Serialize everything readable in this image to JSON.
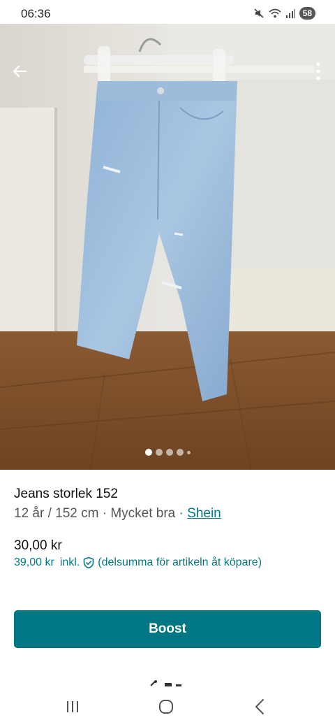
{
  "status_bar": {
    "time": "06:36",
    "battery": "58"
  },
  "photo": {
    "slide_count": 5,
    "active_slide": 1
  },
  "item": {
    "title": "Jeans storlek 152",
    "details": "12 år / 152 cm · Mycket bra · ",
    "brand": "Shein",
    "price": "30,00 kr",
    "price_incl": "39,00 kr",
    "incl_label": "inkl.",
    "incl_note": "(delsumma för artikeln åt köpare)"
  },
  "actions": {
    "boost_label": "Boost"
  },
  "colors": {
    "accent": "#007782"
  },
  "icons": {
    "back": "arrow-left-icon",
    "menu": "more-vertical-icon",
    "protection": "shield-check-icon",
    "mute": "mute-icon",
    "wifi": "wifi-icon",
    "signal": "signal-icon",
    "nav_recents": "recents-icon",
    "nav_home": "home-icon",
    "nav_back": "nav-back-icon"
  }
}
